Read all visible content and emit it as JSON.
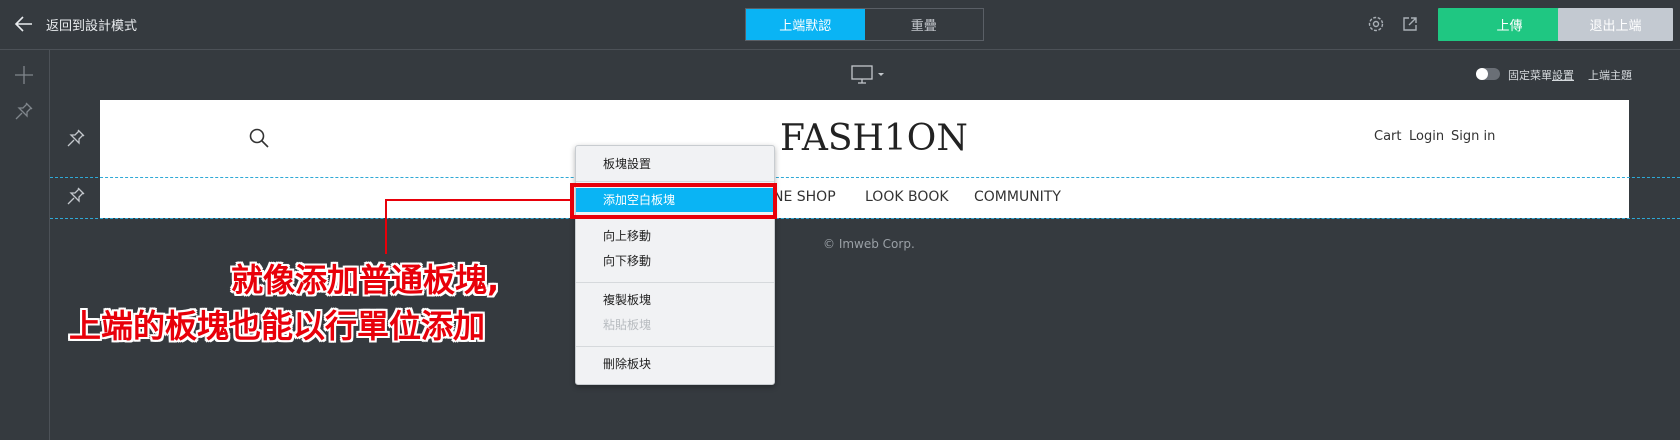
{
  "topbar": {
    "back_label": "返回到設計模式",
    "segments": [
      "上端默認",
      "重疊"
    ],
    "publish_label": "上傳",
    "exit_label": "退出上端"
  },
  "toolbar": {
    "fixed_menu_label": "固定菜單",
    "fixed_menu_link": "設置",
    "top_theme_label": "上端主題"
  },
  "site": {
    "logo": "FASH1ON",
    "utility_links": [
      "Cart",
      "Login",
      "Sign in"
    ],
    "nav_items": [
      "NE SHOP",
      "LOOK BOOK",
      "COMMUNITY"
    ],
    "copyright": "© Imweb Corp."
  },
  "context_menu": {
    "items": [
      "板塊設置",
      "添加空白板塊",
      "向上移動",
      "向下移動",
      "複製板塊",
      "粘貼板塊",
      "刪除板块"
    ]
  },
  "annotation": {
    "line1": "就像添加普通板塊,",
    "line2": "上端的板塊也能以行單位添加"
  },
  "colors": {
    "accent": "#0ab4f4",
    "publish": "#1fc782",
    "annotation_red": "#e8000a"
  }
}
